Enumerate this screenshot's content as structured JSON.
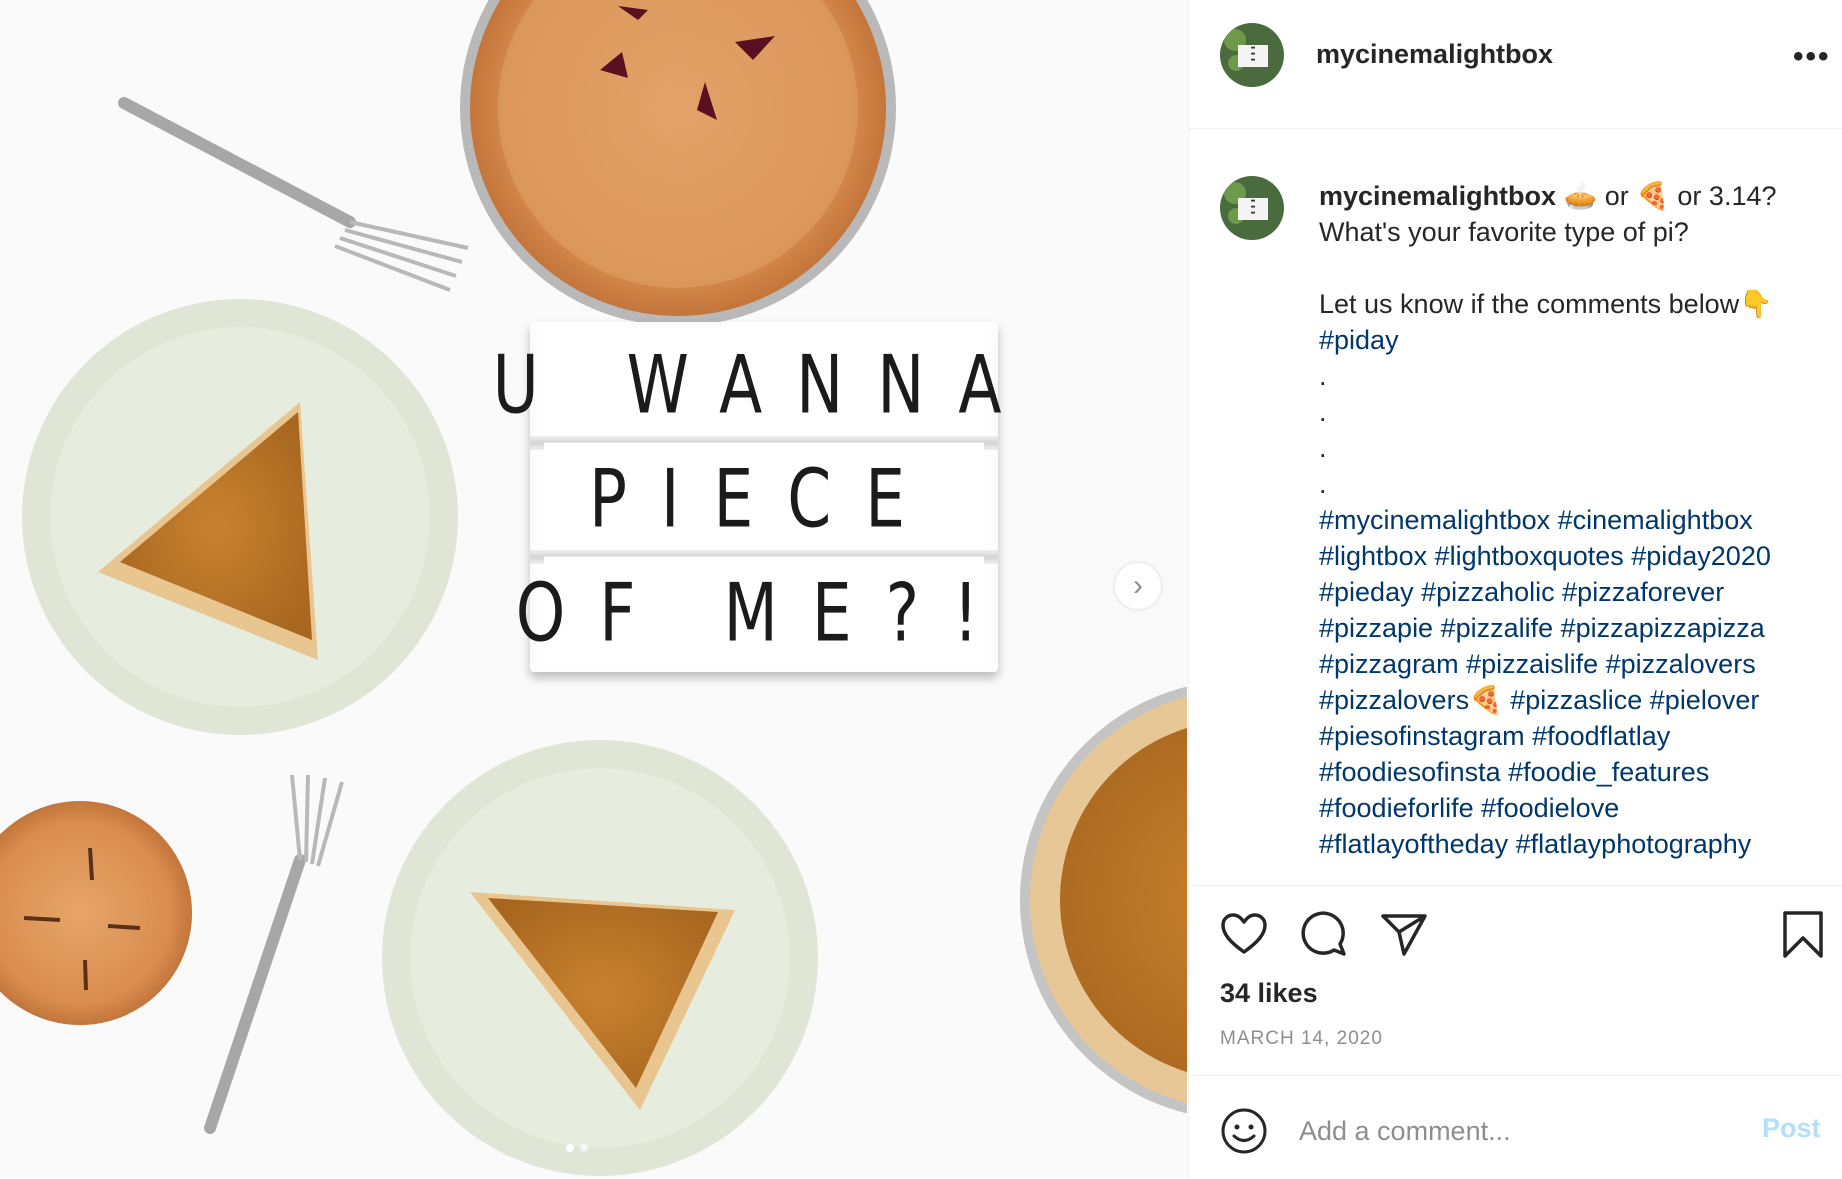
{
  "photo": {
    "lightbox_lines": [
      "U WANNA",
      "PIECE",
      "OF ME?!"
    ],
    "carousel_dots": 2,
    "active_dot": 0
  },
  "header": {
    "username": "mycinemalightbox"
  },
  "caption": {
    "username": "mycinemalightbox",
    "first_line_a": "or",
    "first_line_b": "or",
    "first_line_c": "3.14?",
    "line2": "What's your favorite type of pi?",
    "line4": "Let us know if the comments below",
    "line5": "#piday",
    "dot": ".",
    "tag_lines": [
      "#mycinemalightbox #cinemalightbox",
      "#lightbox #lightboxquotes #piday2020",
      "#pieday #pizzaholic #pizzaforever",
      "#pizzapie #pizzalife #pizzapizzapizza",
      "#pizzagram #pizzaislife #pizzalovers",
      "#pizzalovers",
      "#piesofinstagram #foodflatlay",
      "#foodiesofinsta #foodie_features",
      "#foodieforlife #foodielove",
      "#flatlayoftheday #flatlayphotography"
    ],
    "tag_line6_rest": "#pizzaslice #pielover"
  },
  "stats": {
    "likes": "34 likes",
    "date": "MARCH 14, 2020"
  },
  "comment": {
    "placeholder": "Add a comment...",
    "post_label": "Post"
  },
  "icons": {
    "heart": "heart-icon",
    "comment": "comment-icon",
    "share": "paper-plane-icon",
    "save": "bookmark-icon",
    "emoji": "smiley-icon",
    "next": "chevron-right-icon",
    "more": "more-dots-icon"
  },
  "colors": {
    "hashtag": "#00376b",
    "post_disabled": "#b2dffc",
    "muted": "#8e8e8e"
  }
}
